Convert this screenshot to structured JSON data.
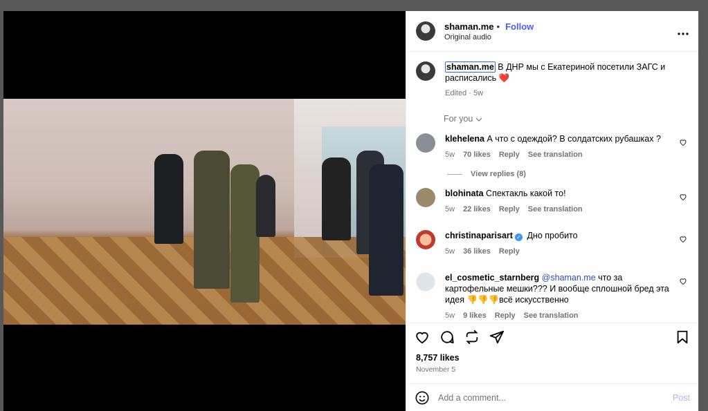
{
  "header": {
    "username": "shaman.me",
    "separator": "•",
    "follow_label": "Follow",
    "audio": "Original audio",
    "more_icon": "more-horizontal-icon"
  },
  "caption": {
    "username": "shaman.me",
    "text": "В ДНР мы с Екатериной посетили ЗАГС и расписались ❤️",
    "edited": "Edited",
    "time": "5w"
  },
  "for_you": "For you",
  "comments": [
    {
      "username": "klehelena",
      "text": "А что с одеждой? В солдатских рубашках ?",
      "time": "5w",
      "likes": "70 likes",
      "reply": "Reply",
      "translate": "See translation",
      "avatar_color": "#8a8f95"
    },
    {
      "username": "blohinata",
      "text": "Спектакль какой то!",
      "time": "5w",
      "likes": "22 likes",
      "reply": "Reply",
      "translate": "See translation",
      "avatar_color": "#9b8a6a"
    },
    {
      "username": "christinaparisart",
      "text": "Дно пробито",
      "time": "5w",
      "likes": "36 likes",
      "reply": "Reply",
      "avatar_color": "#c0392b"
    },
    {
      "username": "el_cosmetic_starnberg",
      "mention": "@shaman.me",
      "text": "что за картофельные мешки??? И вообще сплошной бред эта идея 👎👎👎всё искусственно",
      "time": "5w",
      "likes": "9 likes",
      "reply": "Reply",
      "translate": "See translation",
      "avatar_color": "#dfe6ea"
    }
  ],
  "view_replies": "View replies (8)",
  "actions": {
    "like_icon": "heart-icon",
    "comment_icon": "comment-icon",
    "repost_icon": "repost-icon",
    "share_icon": "send-icon",
    "save_icon": "bookmark-icon"
  },
  "likes": "8,757 likes",
  "date": "November 5",
  "add_comment": {
    "emoji_icon": "emoji-icon",
    "placeholder": "Add a comment...",
    "post_label": "Post"
  },
  "video": {
    "mute_icon": "muted-speaker-icon"
  }
}
